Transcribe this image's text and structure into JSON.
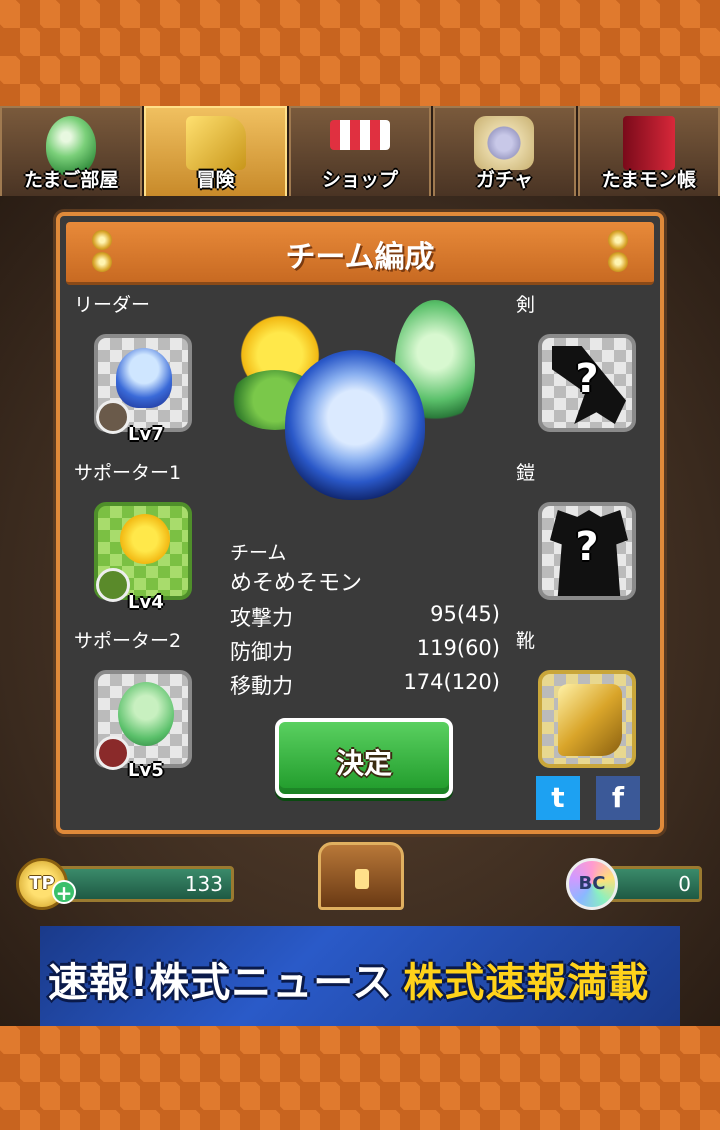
{
  "tabs": [
    {
      "label": "たまご部屋",
      "icon": "egg-icon",
      "active": false
    },
    {
      "label": "冒険",
      "icon": "boots-icon",
      "active": true
    },
    {
      "label": "ショップ",
      "icon": "shop-icon",
      "active": false
    },
    {
      "label": "ガチャ",
      "icon": "gacha-scroll-icon",
      "active": false
    },
    {
      "label": "たまモン帳",
      "icon": "book-icon",
      "active": false
    }
  ],
  "panel": {
    "title": "チーム編成",
    "leader": {
      "label": "リーダー",
      "level": "Lv7",
      "badge_icon": "shield-icon"
    },
    "supporter1": {
      "label": "サポーター1",
      "level": "Lv4",
      "badge_icon": "boot-icon"
    },
    "supporter2": {
      "label": "サポーター2",
      "level": "Lv5",
      "badge_icon": "sword-icon"
    },
    "equipment": {
      "sword_label": "剣",
      "armor_label": "鎧",
      "boots_label": "靴",
      "unknown_mark": "?"
    },
    "team": {
      "label": "チーム",
      "name": "めそめそモン",
      "stats": [
        {
          "name": "攻撃力",
          "value": "95(45)"
        },
        {
          "name": "防御力",
          "value": "119(60)"
        },
        {
          "name": "移動力",
          "value": "174(120)"
        }
      ]
    },
    "decide_label": "決定",
    "twitter_glyph": "t",
    "facebook_glyph": "f"
  },
  "currency": {
    "tp_label": "TP",
    "tp_value": "133",
    "tp_plus": "+",
    "bc_label": "BC",
    "bc_value": "0"
  },
  "ad": {
    "text_white": "速報!株式ニュース",
    "text_yellow": "株式速報満載"
  },
  "colors": {
    "accent_orange": "#e08a3a",
    "button_green": "#1f9a2a",
    "panel_bg": "#3a3a3a"
  }
}
